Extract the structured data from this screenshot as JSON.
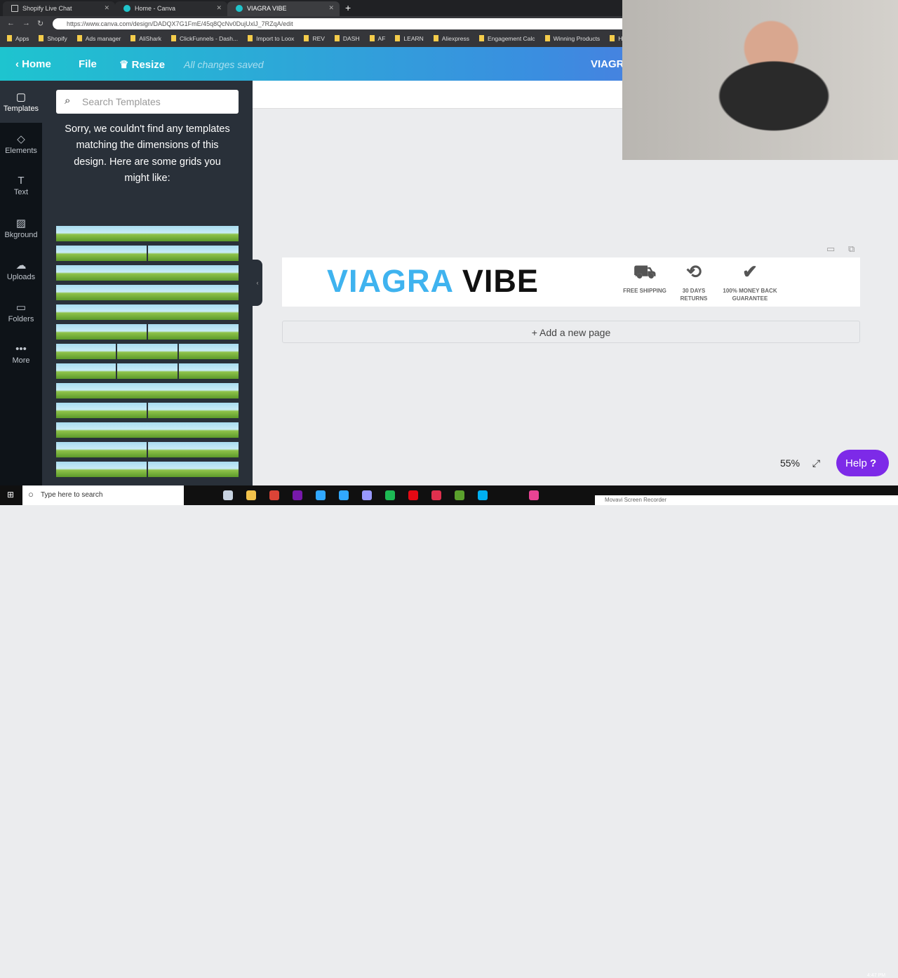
{
  "browser": {
    "tabs": [
      {
        "label": "Shopify Live Chat"
      },
      {
        "label": "Home - Canva"
      },
      {
        "label": "VIAGRA VIBE"
      }
    ],
    "url": "https://www.canva.com/design/DADQX7G1FmE/45q8QcNv0DujUxlJ_7RZqA/edit",
    "bookmarks": [
      "Apps",
      "Shopify",
      "Ads manager",
      "AliShark",
      "ClickFunnels - Dash...",
      "Import to Loox",
      "REV",
      "DASH",
      "AF",
      "LEARN",
      "Aliexpress",
      "Engagement Calc",
      "Winning Products",
      "HYPR"
    ]
  },
  "header": {
    "home": "Home",
    "file": "File",
    "resize": "Resize",
    "status": "All changes saved",
    "title": "VIAGRA"
  },
  "rail": [
    {
      "label": "Templates",
      "icon": "templates-icon",
      "g": "▢"
    },
    {
      "label": "Elements",
      "icon": "elements-icon",
      "g": "◇"
    },
    {
      "label": "Text",
      "icon": "text-icon",
      "g": "T"
    },
    {
      "label": "Bkground",
      "icon": "background-icon",
      "g": "▨"
    },
    {
      "label": "Uploads",
      "icon": "upload-icon",
      "g": "☁"
    },
    {
      "label": "Folders",
      "icon": "folder-icon",
      "g": "▭"
    },
    {
      "label": "More",
      "icon": "more-icon",
      "g": "•••"
    }
  ],
  "panel": {
    "search_placeholder": "Search Templates",
    "message": "Sorry, we couldn't find any templates matching the dimensions of this design. Here are some grids you might like:"
  },
  "design": {
    "logo_part1": "VIAGRA",
    "logo_part2": "VIBE",
    "badges": [
      {
        "label": "FREE SHIPPING",
        "icon": "truck-icon"
      },
      {
        "label": "30 DAYS RETURNS",
        "icon": "returns-icon"
      },
      {
        "label": "100% MONEY BACK GUARANTEE",
        "icon": "check-badge-icon"
      }
    ]
  },
  "add_page": "+ Add a new page",
  "zoom": "55%",
  "help": "Help",
  "taskbar": {
    "search": "Type here to search",
    "time": "4:47 PM",
    "recorder": "Movavi Screen Recorder"
  },
  "colors": {
    "logo_blue": "#3fb3ef",
    "help_purple": "#7d2ae8",
    "header_start": "#1ec4cf",
    "header_end": "#6a5fe0"
  }
}
